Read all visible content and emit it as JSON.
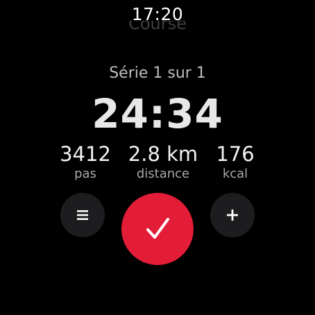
{
  "status": {
    "time": "17:20"
  },
  "activity": {
    "title": "Course"
  },
  "workout": {
    "series_label": "Série 1 sur 1",
    "elapsed": "24:34"
  },
  "stats": [
    {
      "value": "3412",
      "label": "pas"
    },
    {
      "value": "2.8 km",
      "label": "distance"
    },
    {
      "value": "176",
      "label": "kcal"
    }
  ],
  "controls": {
    "menu_icon": "menu-icon",
    "finish_icon": "checkmark-icon",
    "add_icon": "plus-icon",
    "finish_color": "#e31d37",
    "secondary_button_color": "#1d1d1f"
  }
}
